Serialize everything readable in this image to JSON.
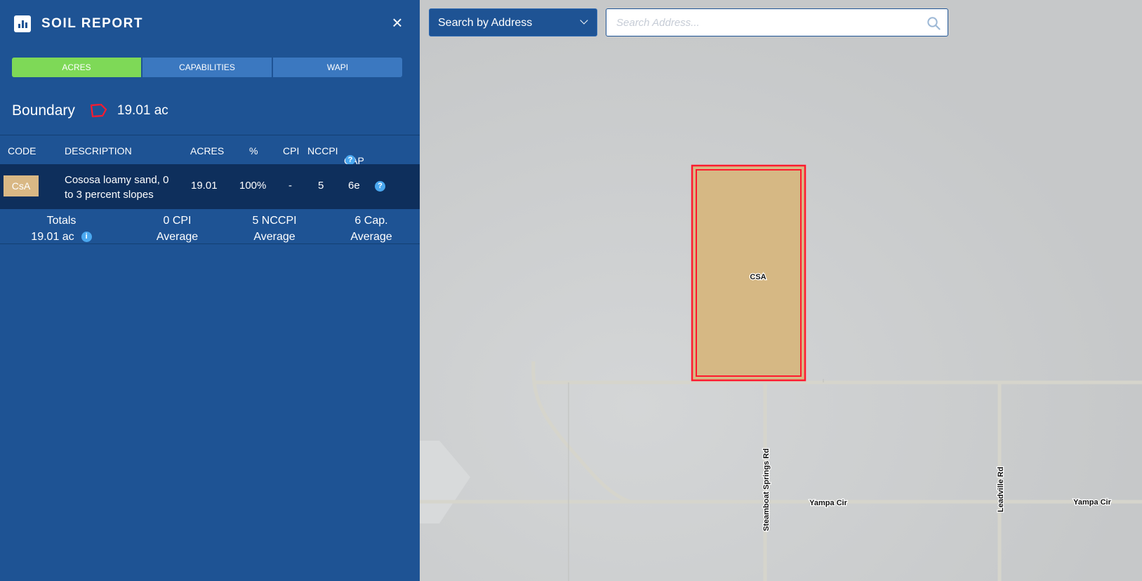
{
  "panel": {
    "title": "SOIL REPORT",
    "close_symbol": "×",
    "tabs": [
      {
        "label": "ACRES",
        "active": true
      },
      {
        "label": "CAPABILITIES",
        "active": false
      },
      {
        "label": "WAPI",
        "active": false
      }
    ],
    "boundary": {
      "label": "Boundary",
      "acres": "19.01 ac",
      "icon": "polygon-icon"
    }
  },
  "table": {
    "headers": {
      "code": "CODE",
      "description": "DESCRIPTION",
      "acres": "ACRES",
      "percent": "%",
      "cpi": "CPI",
      "nccpi": "NCCPI",
      "cap": "CAP"
    },
    "help_symbol": "?",
    "rows": [
      {
        "code": "CsA",
        "description": "Cososa loamy sand, 0 to 3 percent slopes",
        "acres": "19.01",
        "percent": "100%",
        "cpi": "-",
        "nccpi": "5",
        "cap": "6e"
      }
    ],
    "totals": {
      "label": "Totals",
      "acres": "19.01 ac",
      "info_symbol": "i",
      "cpi_value": "0 CPI",
      "nccpi_value": "5 NCCPI",
      "cap_value": "6 Cap.",
      "average_label": "Average"
    }
  },
  "map": {
    "search_mode": "Search by Address",
    "search_placeholder": "Search Address...",
    "search_value": "",
    "parcel_label": "CSA",
    "roads": [
      "Steamboat Springs Rd",
      "Leadville Rd",
      "Yampa Cir",
      "Yampa Cir"
    ]
  },
  "colors": {
    "panel_bg": "#1e5394",
    "active_tab": "#7ed957",
    "tab": "#3b78c0",
    "soil_chip": "#d9b885",
    "boundary": "#ff1a2e",
    "help_icon": "#4aa8f0"
  }
}
